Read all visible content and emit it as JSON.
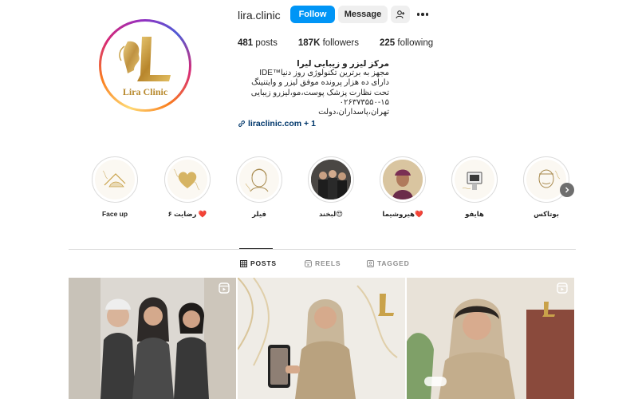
{
  "profile": {
    "username": "lira.clinic",
    "avatar_caption": "Lira Clinic",
    "follow_label": "Follow",
    "message_label": "Message",
    "posts_count": "481",
    "posts_label": "posts",
    "followers_count": "187K",
    "followers_label": "followers",
    "following_count": "225",
    "following_label": "following",
    "bio_name": "مرکز لیزر و زیبایی لیرا",
    "bio_lines": [
      "مجهز به برترین تکنولوژی روز دنیا™IDE",
      "دارای ده هزار پرونده موفق لیزر و وایتنینگ",
      "تحت نظارت پزشک پوست،مو،لیزرو زیبایی",
      "۰۲۶۳۷۳۵۵۰-۱۵",
      "تهران،پاسداران،دولت"
    ],
    "link_text": "liraclinic.com + 1"
  },
  "highlights": [
    {
      "label": "Face up",
      "icon": "face-mask-icon"
    },
    {
      "label": "رضایت ۶ ❤️",
      "icon": "heart-icon"
    },
    {
      "label": "فیلر",
      "icon": "face-filler-icon"
    },
    {
      "label": "لبخند😍",
      "icon": "photo-people-icon"
    },
    {
      "label": "هیروشیما❤️",
      "icon": "portrait-photo-icon"
    },
    {
      "label": "هایفو",
      "icon": "device-icon"
    },
    {
      "label": "بوتاکس",
      "icon": "face-botox-icon"
    }
  ],
  "tabs": [
    {
      "label": "POSTS",
      "icon": "grid-icon",
      "active": true
    },
    {
      "label": "REELS",
      "icon": "reels-icon",
      "active": false
    },
    {
      "label": "TAGGED",
      "icon": "tagged-icon",
      "active": false
    }
  ],
  "posts": [
    {
      "type": "reel",
      "icon": "reel-icon"
    },
    {
      "type": "photo"
    },
    {
      "type": "reel",
      "icon": "reel-icon"
    }
  ],
  "colors": {
    "follow_button": "#0095f6",
    "secondary_button": "#efefef",
    "link": "#00376b",
    "gold": "#c9a24a"
  }
}
